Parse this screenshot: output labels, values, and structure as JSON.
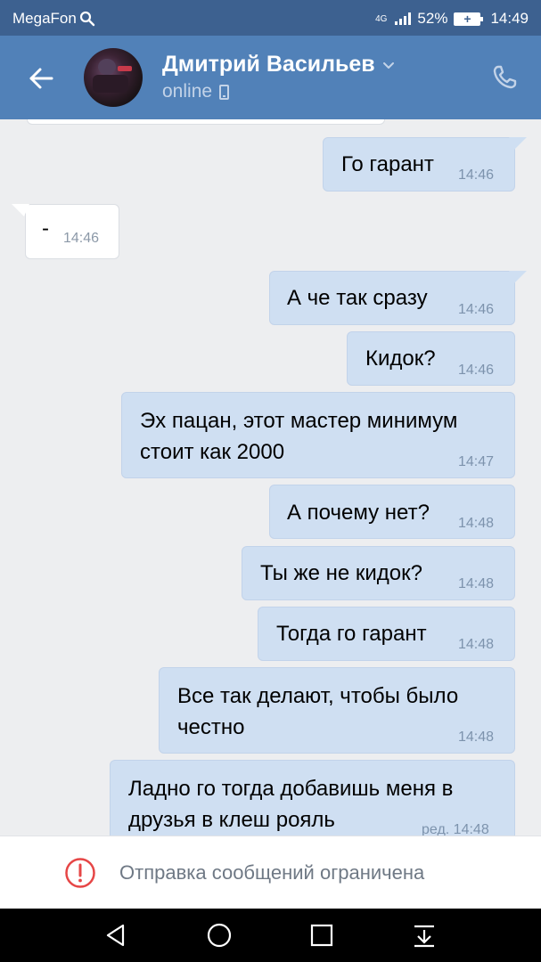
{
  "status_bar": {
    "carrier": "MegaFon",
    "network": "4G",
    "battery": "52%",
    "time": "14:49"
  },
  "header": {
    "name": "Дмитрий Васильев",
    "status": "online"
  },
  "messages": [
    {
      "dir": "out",
      "text": "Го гарант",
      "time": "14:46"
    },
    {
      "dir": "in",
      "text": "-",
      "time": "14:46"
    },
    {
      "dir": "out",
      "text": "А че так сразу",
      "time": "14:46"
    },
    {
      "dir": "out",
      "text": "Кидок?",
      "time": "14:46"
    },
    {
      "dir": "out",
      "lines": [
        "Эх пацан, этот мастер минимум",
        "стоит как 2000"
      ],
      "time": "14:47"
    },
    {
      "dir": "out",
      "text": "А почему нет?",
      "time": "14:48"
    },
    {
      "dir": "out",
      "text": "Ты же не кидок?",
      "time": "14:48"
    },
    {
      "dir": "out",
      "text": "Тогда го гарант",
      "time": "14:48"
    },
    {
      "dir": "out",
      "lines": [
        "Все так делают, чтобы было",
        "честно"
      ],
      "time": "14:48"
    },
    {
      "dir": "out",
      "lines": [
        "Ладно го тогда добавишь меня в",
        "друзья в клеш рояль"
      ],
      "time": "ред. 14:48"
    }
  ],
  "restricted": {
    "label": "Отправка сообщений ограничена"
  },
  "colors": {
    "status_bar": "#3d6190",
    "header": "#5181b8",
    "outgoing_bubble": "#cfdff2",
    "incoming_bubble": "#ffffff",
    "background": "#edeef0",
    "warning": "#e64646"
  },
  "icons": {
    "back": "arrow-left-icon",
    "call": "phone-icon",
    "warning": "exclamation-circle-icon",
    "nav_back": "triangle-back-icon",
    "nav_home": "circle-home-icon",
    "nav_recents": "square-recents-icon",
    "nav_notifications": "pull-down-icon"
  }
}
